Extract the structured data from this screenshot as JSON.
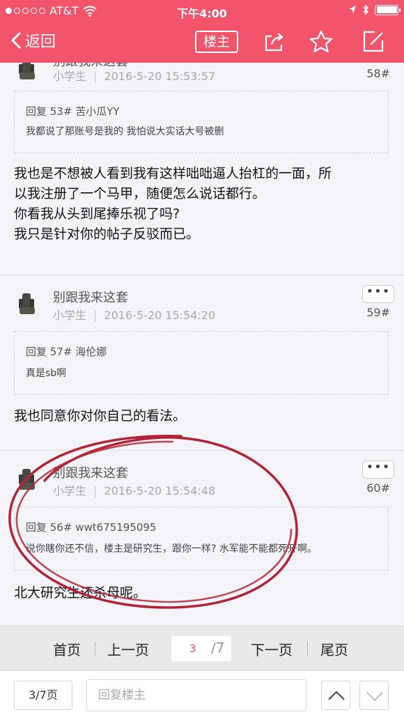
{
  "status_bar": {
    "carrier": "AT&T",
    "time": "下午4:00"
  },
  "nav": {
    "back_label": "返回",
    "louzhu_label": "楼主"
  },
  "posts": [
    {
      "user": "别跟我来这套",
      "role": "小学生",
      "time": "2016-5-20 15:53:57",
      "floor": "58#",
      "quote_head": "回复 53# 苦小瓜YY",
      "quote_text": "我都说了那账号是我的 我怕说大实话大号被删",
      "body": [
        "我也是不想被人看到我有这样咄咄逼人抬杠的一面，所",
        "以我注册了一个马甲，随便怎么说话都行。",
        "你看我从头到尾捧乐视了吗?",
        "我只是针对你的帖子反驳而已。"
      ]
    },
    {
      "user": "别跟我来这套",
      "role": "小学生",
      "time": "2016-5-20 15:54:20",
      "floor": "59#",
      "more": "•••",
      "quote_head": "回复 57# 海伦娜",
      "quote_text": "真是sb啊",
      "body": [
        "我也同意你对你自己的看法。"
      ]
    },
    {
      "user": "别跟我来这套",
      "role": "小学生",
      "time": "2016-5-20 15:54:48",
      "floor": "60#",
      "more": "•••",
      "quote_head": "回复 56# wwt675195095",
      "quote_text": "说你瞎你还不信，楼主是研究生，跟你一样? 水军能不能都死开啊。",
      "body": [
        "北大研究生还杀母呢。"
      ]
    }
  ],
  "pager": {
    "first": "首页",
    "prev": "上一页",
    "current": "3",
    "total": "/7",
    "next": "下一页",
    "last": "尾页"
  },
  "bottom": {
    "page_indicator": "3/7页",
    "reply_placeholder": "回复楼主"
  },
  "colors": {
    "header": "#f2546b",
    "annotation_circle": "#b0243a"
  }
}
